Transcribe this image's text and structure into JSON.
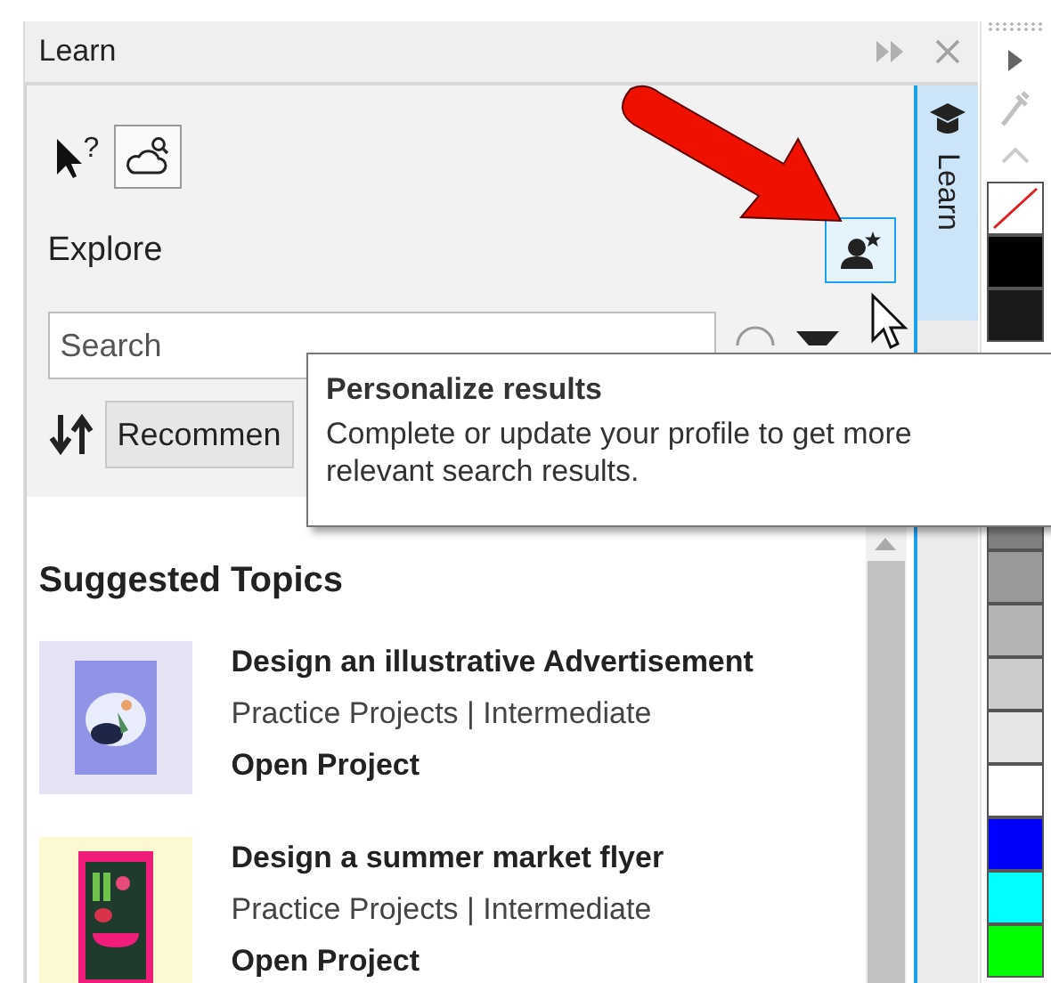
{
  "panel": {
    "title": "Learn"
  },
  "help_tool": {
    "mark": "?"
  },
  "explore": {
    "heading": "Explore",
    "personalize_hovered": true
  },
  "search": {
    "placeholder": "Search"
  },
  "sort": {
    "value": "Recommen"
  },
  "tooltip": {
    "title": "Personalize results",
    "text": "Complete or update your profile to get more relevant search results."
  },
  "topics": {
    "heading": "Suggested Topics",
    "items": [
      {
        "title": "Design an illustrative Advertisement",
        "meta": "Practice Projects | Intermediate",
        "action": "Open Project"
      },
      {
        "title": "Design a summer market flyer",
        "meta": "Practice Projects | Intermediate",
        "action": "Open Project"
      }
    ]
  },
  "side_tab": {
    "label": "Learn",
    "selected": true
  },
  "palette": {
    "swatches_top": [
      {
        "kind": "none"
      },
      {
        "kind": "color",
        "color": "#000000"
      },
      {
        "kind": "color",
        "color": "#1a1a1a"
      }
    ],
    "swatches_bottom": [
      {
        "kind": "color",
        "color": "#808080"
      },
      {
        "kind": "color",
        "color": "#999999"
      },
      {
        "kind": "color",
        "color": "#b3b3b3"
      },
      {
        "kind": "color",
        "color": "#cccccc"
      },
      {
        "kind": "color",
        "color": "#e6e6e6"
      },
      {
        "kind": "color",
        "color": "#ffffff"
      },
      {
        "kind": "color",
        "color": "#0000ff"
      },
      {
        "kind": "color",
        "color": "#00ffff"
      },
      {
        "kind": "color",
        "color": "#00ff00"
      }
    ]
  }
}
